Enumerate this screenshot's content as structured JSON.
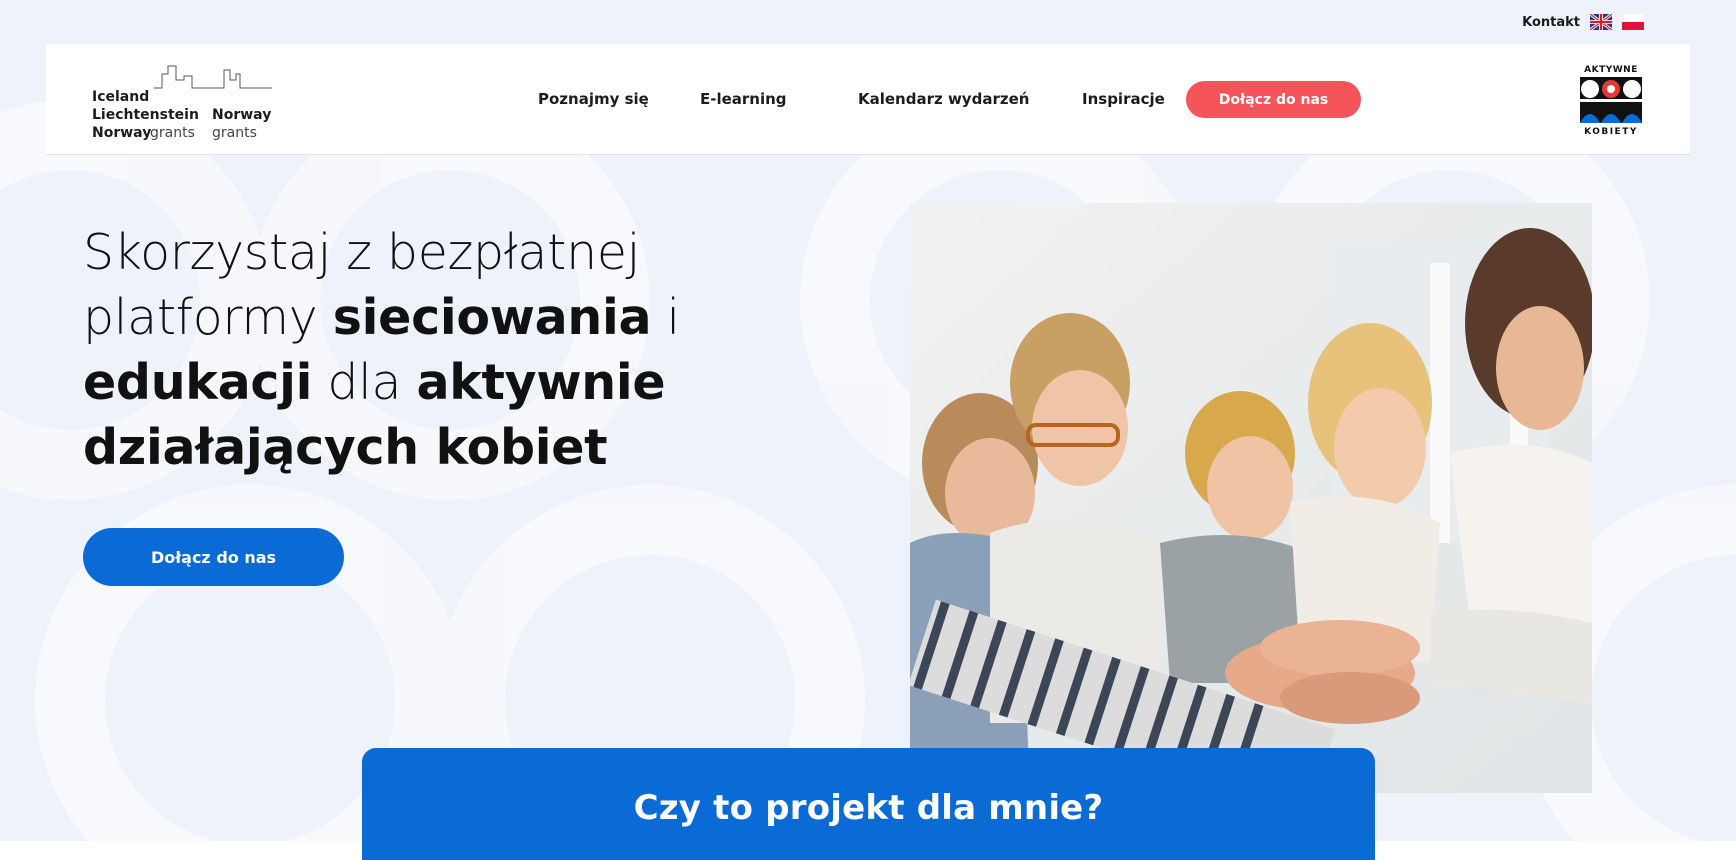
{
  "topbar": {
    "contact_label": "Kontakt",
    "languages": [
      {
        "code": "en",
        "icon": "uk-flag-icon"
      },
      {
        "code": "pl",
        "icon": "pl-flag-icon"
      }
    ]
  },
  "header": {
    "grants_logo": {
      "line1": "Iceland",
      "line2a": "Liechtenstein",
      "line2b": "Norway",
      "line3a": "Norway",
      "line3b": "grants",
      "line3c": "grants"
    },
    "nav": [
      "Poznajmy się",
      "E-learning",
      "Kalendarz wydarzeń",
      "Inspiracje"
    ],
    "cta_label": "Dołącz do nas",
    "brand_logo": {
      "top": "AKTYWNE",
      "bottom": "KOBIETY"
    }
  },
  "hero": {
    "title_parts": {
      "t1": "Skorzystaj z bezpłatnej",
      "t2": "platformy ",
      "t3": "sieciowania",
      "t4": " i",
      "t5": "edukacji",
      "t6": " dla ",
      "t7": "aktywnie",
      "t8": "działających kobiet"
    },
    "cta_label": "Dołącz do nas",
    "photo": {
      "subject": "group-of-smiling-women-stacking-hands"
    }
  },
  "section": {
    "title": "Czy to projekt dla mnie?"
  },
  "colors": {
    "page_bg": "#eef2fa",
    "brand_blue": "#0a6bd6",
    "accent_red": "#f6545b",
    "header_bg": "#ffffff"
  }
}
